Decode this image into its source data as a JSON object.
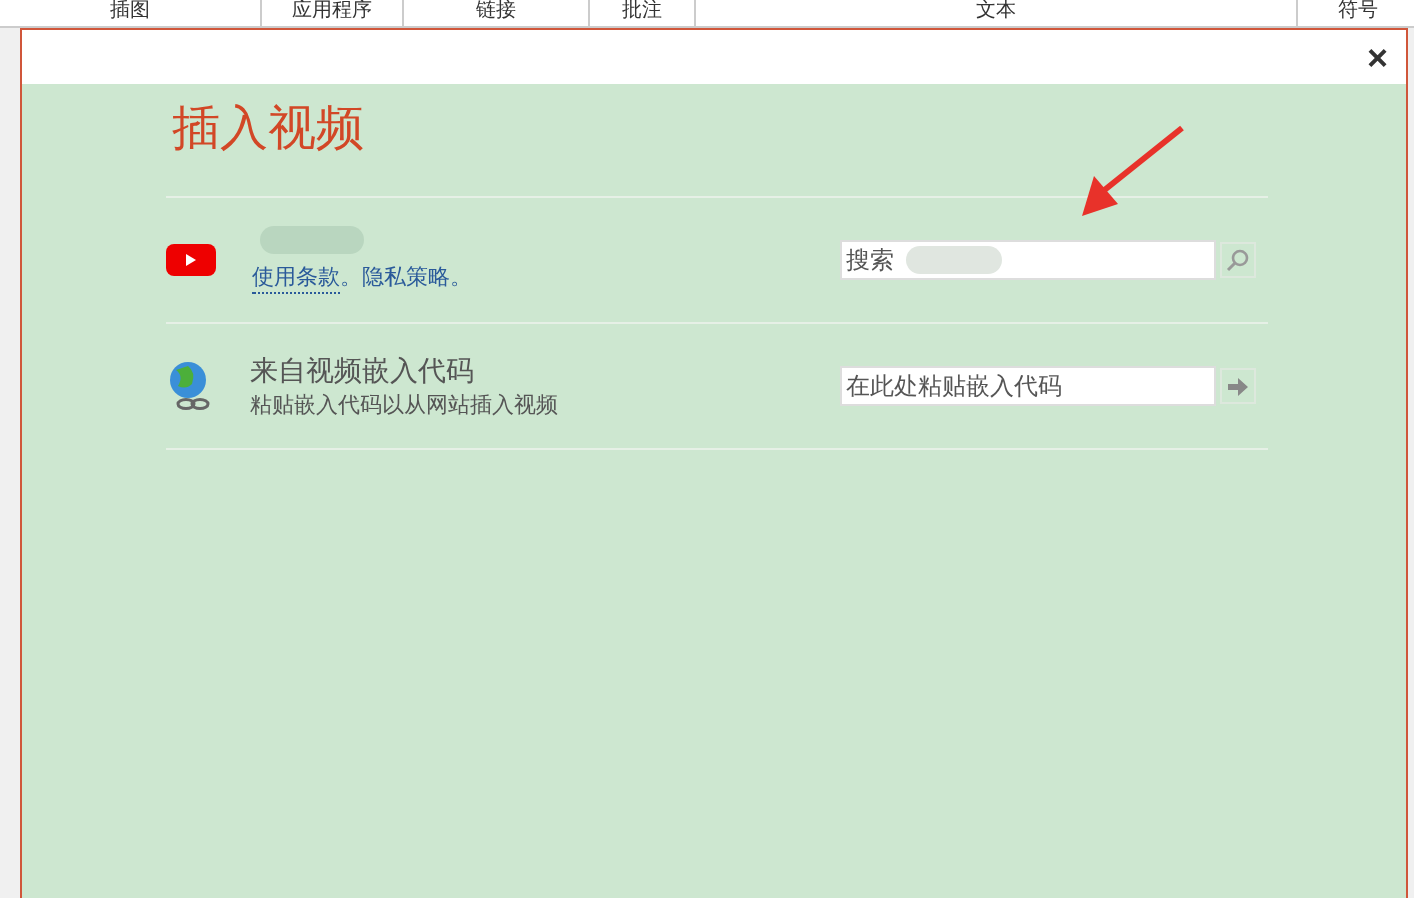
{
  "ribbon_groups": [
    "插图",
    "应用程序",
    "链接",
    "批注",
    "文本",
    "符号"
  ],
  "dialog": {
    "close": "×",
    "title": "插入视频",
    "sources": [
      {
        "kind": "youtube",
        "links": [
          "使用条款",
          "隐私策略"
        ],
        "separator": "。",
        "field": {
          "placeholder": "搜索"
        }
      },
      {
        "kind": "embed",
        "name": "来自视频嵌入代码",
        "description": "粘贴嵌入代码以从网站插入视频",
        "field": {
          "placeholder": "在此处粘贴嵌入代码"
        }
      }
    ]
  }
}
